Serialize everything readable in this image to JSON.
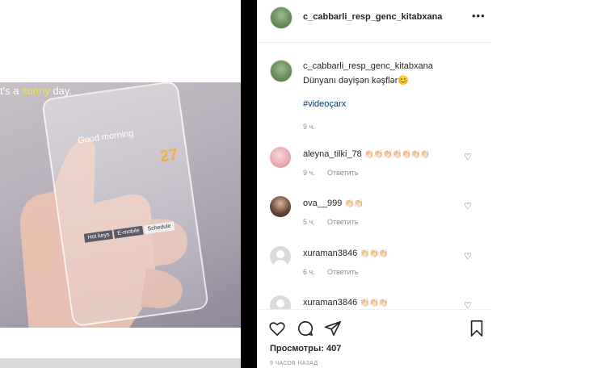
{
  "video": {
    "caption_prefix": "t's a ",
    "caption_highlight": "sunny",
    "caption_suffix": " day.",
    "greeting": "Good morning",
    "time_value": "27",
    "tabs": [
      "Hot keys",
      "E-mobile",
      "Schedule"
    ]
  },
  "post": {
    "username": "c_cabbarli_resp_genc_kitabxana",
    "more_icon": "more-horizontal-icon",
    "caption": {
      "username": "c_cabbarli_resp_genc_kitabxana",
      "text": "Dünyanı dəyişən kəşflər😊",
      "hashtag": "#videoçarx",
      "time": "9 ч."
    }
  },
  "comments": [
    {
      "user": "aleyna_tilki_78",
      "emoji": "👏🏻👏🏻👏🏻👏🏻👏🏻👏🏻👏🏻",
      "time": "9 ч.",
      "reply": "Ответить",
      "avatar": "pink"
    },
    {
      "user": "ova__999",
      "emoji": "👏🏻👏🏻",
      "time": "5 ч.",
      "reply": "Ответить",
      "avatar": "dark"
    },
    {
      "user": "xuraman3846",
      "emoji": "👏🏻👏🏻👏🏻",
      "time": "6 ч.",
      "reply": "Ответить",
      "avatar": "grey"
    },
    {
      "user": "xuraman3846",
      "emoji": "👏🏻👏🏻👏🏻",
      "time": "",
      "reply": "",
      "avatar": "grey"
    }
  ],
  "actions": {
    "icons": [
      "heart-icon",
      "comment-icon",
      "share-icon",
      "bookmark-icon"
    ],
    "views": "Просмотры: 407",
    "posted": "9 ЧАСОВ НАЗАД"
  },
  "colors": {
    "text": "#262626",
    "muted": "#8e8e8e",
    "link": "#00376b",
    "divider": "#000000"
  }
}
